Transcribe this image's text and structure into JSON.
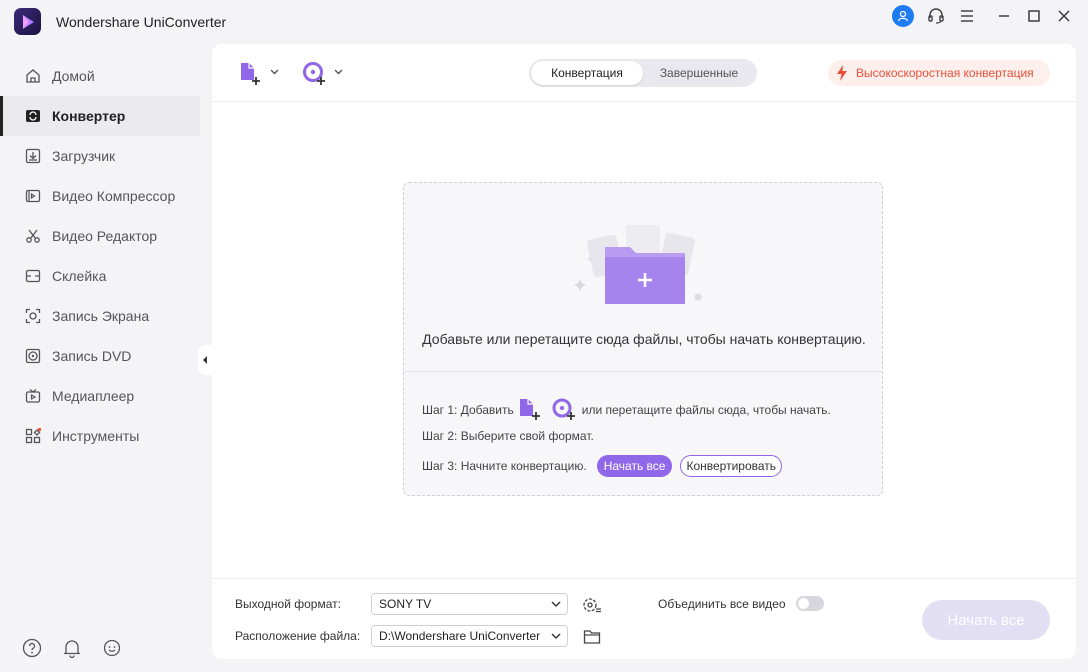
{
  "app": {
    "title": "Wondershare UniConverter"
  },
  "sidebar": {
    "items": [
      {
        "label": "Домой",
        "icon": "home-icon"
      },
      {
        "label": "Конвертер",
        "icon": "convert-icon",
        "active": true
      },
      {
        "label": "Загрузчик",
        "icon": "download-icon"
      },
      {
        "label": "Видео Компрессор",
        "icon": "compress-icon"
      },
      {
        "label": "Видео Редактор",
        "icon": "scissors-icon"
      },
      {
        "label": "Склейка",
        "icon": "merge-icon"
      },
      {
        "label": "Запись Экрана",
        "icon": "screen-record-icon"
      },
      {
        "label": "Запись DVD",
        "icon": "dvd-icon"
      },
      {
        "label": "Медиаплеер",
        "icon": "tv-icon"
      },
      {
        "label": "Инструменты",
        "icon": "tools-icon"
      }
    ]
  },
  "toolbar": {
    "tabs": [
      {
        "label": "Конвертация",
        "active": true
      },
      {
        "label": "Завершенные",
        "active": false
      }
    ],
    "high_speed_label": "Высокоскоростная конвертация"
  },
  "drop_zone": {
    "text": "Добавьте или перетащите сюда файлы, чтобы начать конвертацию.",
    "step1_prefix": "Шаг 1: Добавить",
    "step1_suffix": "или перетащите файлы сюда, чтобы начать.",
    "step2": "Шаг 2: Выберите свой формат.",
    "step3": "Шаг 3: Начните конвертацию.",
    "start_all_small": "Начать все",
    "convert_small": "Конвертировать"
  },
  "footer": {
    "output_format_label": "Выходной формат:",
    "output_format_value": "SONY TV",
    "file_location_label": "Расположение файла:",
    "file_location_value": "D:\\Wondershare UniConverter",
    "merge_label": "Объединить все видео",
    "start_all_label": "Начать все"
  },
  "colors": {
    "accent": "#8f67e8",
    "user_blue": "#1e7cf2",
    "high_speed_orange": "#e8503a"
  }
}
